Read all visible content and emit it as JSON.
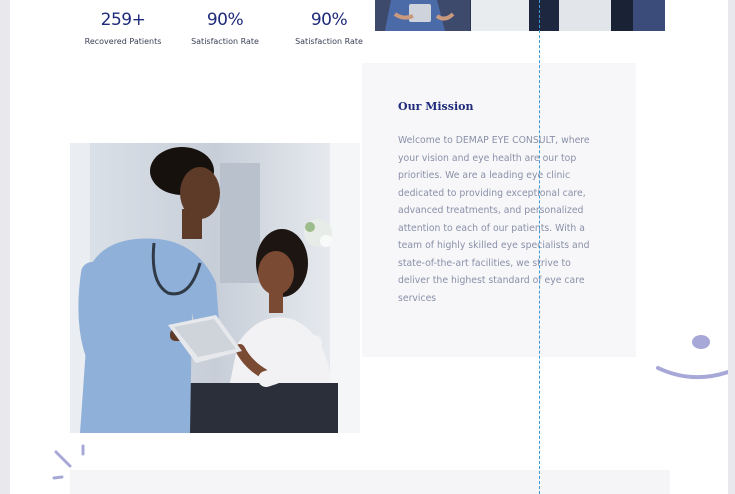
{
  "stats": [
    {
      "value": "259+",
      "label": "Recovered Patients"
    },
    {
      "value": "90%",
      "label": "Satisfaction Rate"
    },
    {
      "value": "90%",
      "label": "Satisfaction Rate"
    }
  ],
  "mission": {
    "title": "Our Mission",
    "body": "Welcome to DEMAP EYE CONSULT, where your vision and eye health are our top priorities. We are a leading eye clinic dedicated to providing exceptional care, advanced treatments, and personalized attention to each of our patients. With a team of highly skilled eye specialists and state-of-the-art facilities, we strive to deliver the highest standard of eye care services"
  },
  "colors": {
    "accent": "#1f2b7a",
    "body_text": "#8a90a8",
    "card_bg": "#f7f7f9",
    "decoration": "#a8a8d8",
    "guide": "#3a9ad6"
  },
  "images": {
    "team_photo": "team-photo",
    "care_photo": "nurse-and-patient-photo"
  }
}
